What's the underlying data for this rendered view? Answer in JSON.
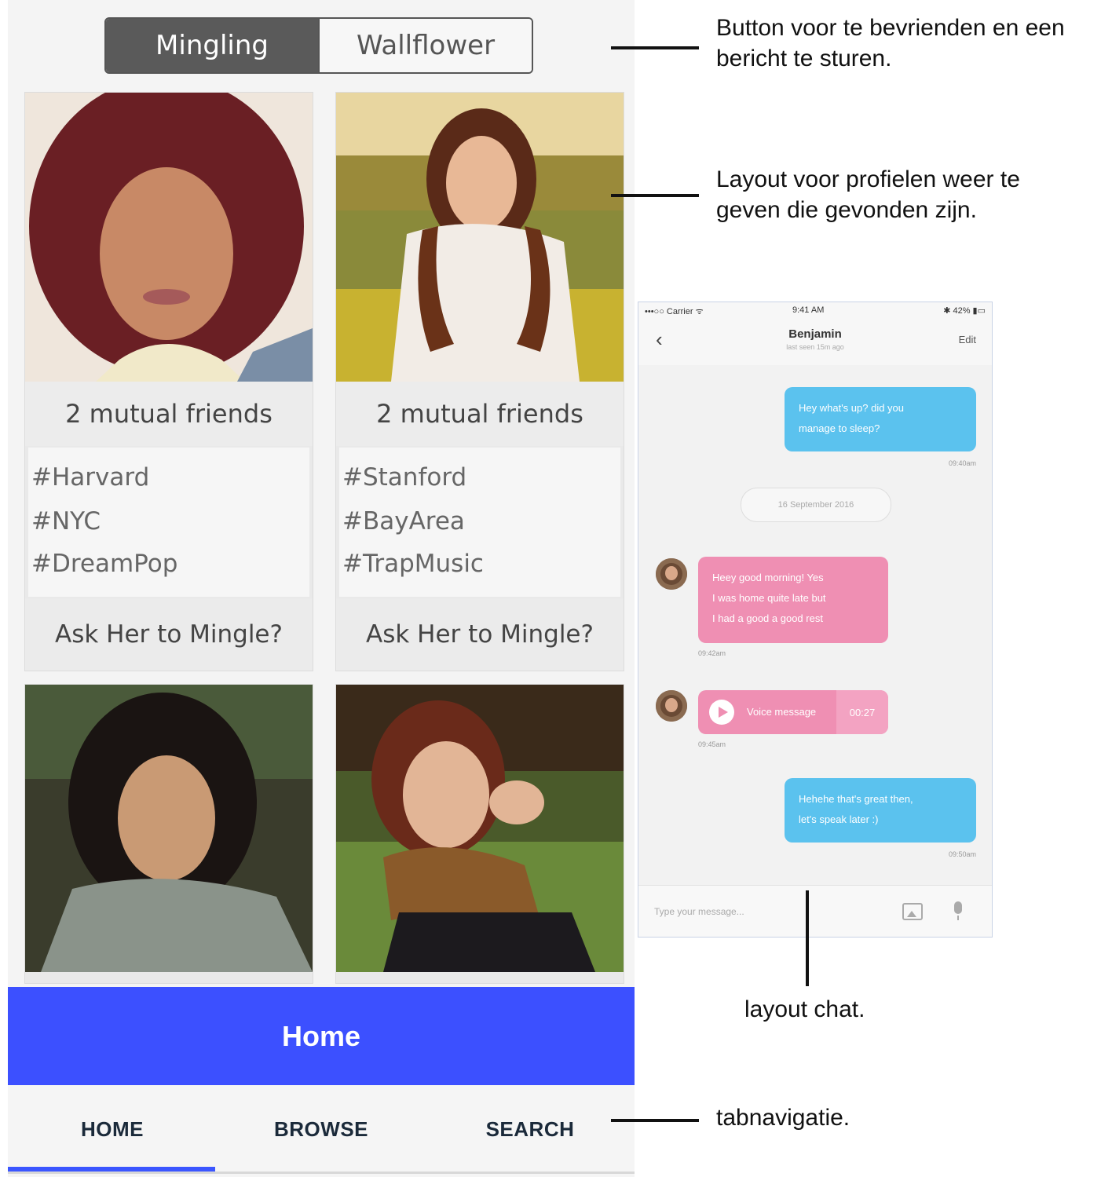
{
  "segmented": {
    "active": "Mingling",
    "inactive": "Wallflower"
  },
  "cards": [
    {
      "mutual": "2 mutual friends",
      "tags": [
        "#Harvard",
        "#NYC",
        "#DreamPop"
      ],
      "ask": "Ask Her to Mingle?"
    },
    {
      "mutual": "2 mutual friends",
      "tags": [
        "#Stanford",
        "#BayArea",
        "#TrapMusic"
      ],
      "ask": "Ask Her to Mingle?"
    }
  ],
  "home_bar": {
    "title": "Home"
  },
  "tabs": [
    {
      "label": "HOME",
      "selected": true
    },
    {
      "label": "BROWSE",
      "selected": false
    },
    {
      "label": "SEARCH",
      "selected": false
    }
  ],
  "chat": {
    "status": {
      "carrier": "•••○○ Carrier ᯤ",
      "time": "9:41 AM",
      "battery": "✱ 42% ▮▭"
    },
    "name": "Benjamin",
    "last_seen": "last seen 15m ago",
    "edit": "Edit",
    "messages": [
      {
        "text_lines": [
          "Hey what's up? did you",
          "manage to sleep?"
        ],
        "time": "09:40am"
      },
      {
        "text_lines": [
          "Heey good morning! Yes",
          "I was home quite late but",
          "I had a good a good rest"
        ],
        "time": "09:42am"
      },
      {
        "text_lines": [
          "Hehehe that's great then,",
          "let's speak later :)"
        ],
        "time": "09:50am"
      }
    ],
    "date_pill": "16 September 2016",
    "voice": {
      "label": "Voice message",
      "duration": "00:27",
      "time": "09:45am"
    },
    "input_placeholder": "Type your message..."
  },
  "annotations": {
    "button": [
      "Button voor te bevrienden en een",
      "bericht te sturen."
    ],
    "layout": [
      "Layout voor profielen weer te",
      "geven die gevonden zijn."
    ],
    "chat": "layout chat.",
    "tabs": "tabnavigatie."
  },
  "colors": {
    "accent_blue": "#3c50ff",
    "chat_blue": "#5bc2ee",
    "chat_pink": "#ef8fb3"
  }
}
